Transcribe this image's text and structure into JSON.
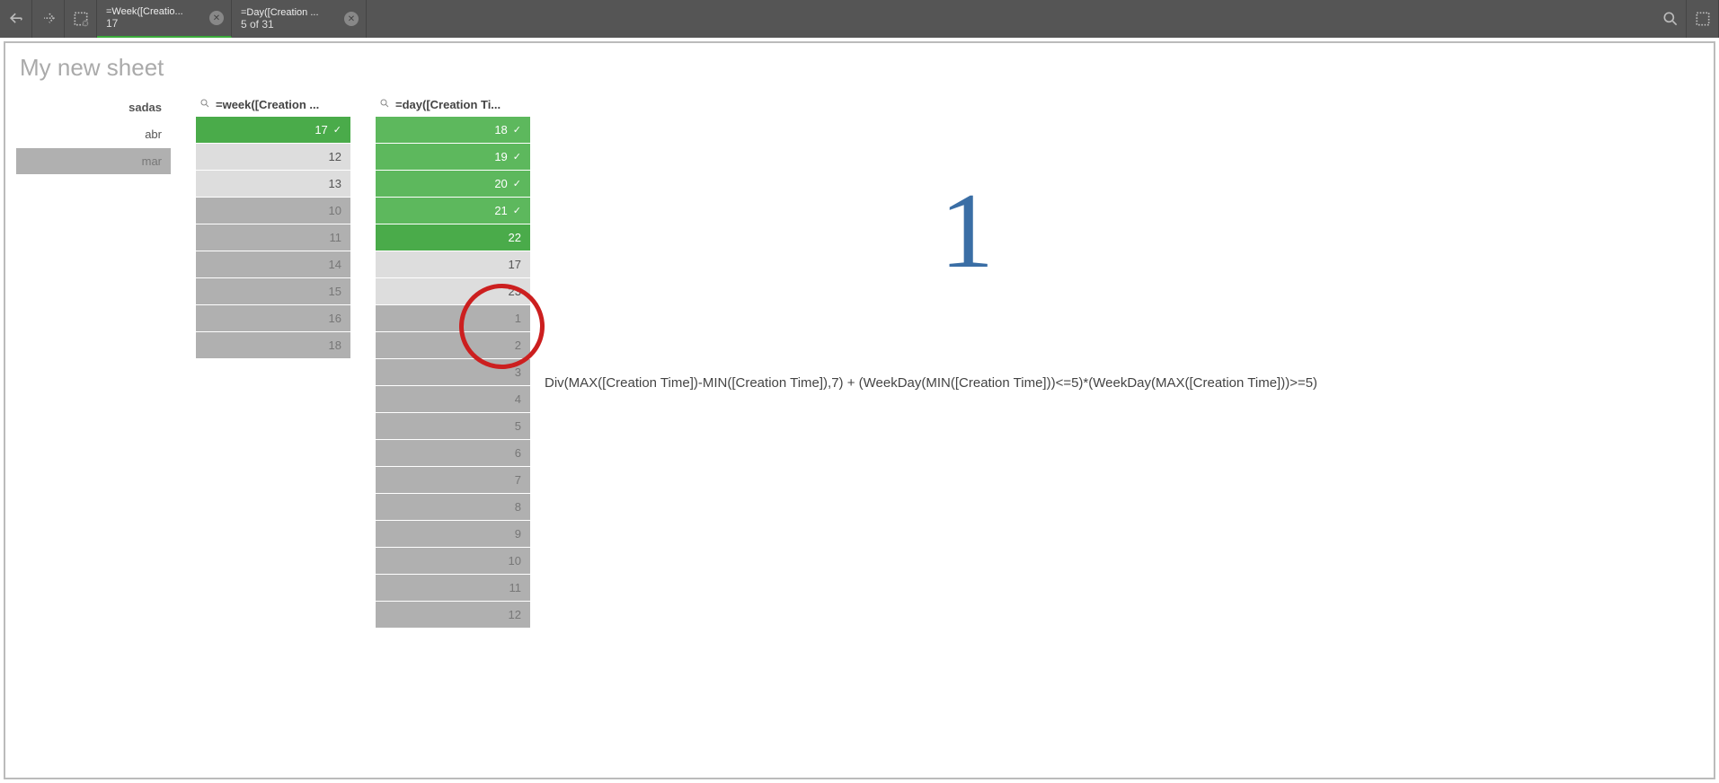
{
  "toolbar": {
    "selections": [
      {
        "title": "=Week([Creatio...",
        "sub": "17"
      },
      {
        "title": "=Day([Creation ...",
        "sub": "5 of 31"
      }
    ]
  },
  "sheet": {
    "title": "My new sheet"
  },
  "panes": {
    "sadas": {
      "header": "sadas",
      "items": [
        {
          "label": "abr",
          "state": "plain"
        },
        {
          "label": "mar",
          "state": "excluded"
        }
      ]
    },
    "week": {
      "header": "=week([Creation ...",
      "items": [
        {
          "label": "17",
          "state": "selected-bright",
          "checked": true
        },
        {
          "label": "12",
          "state": "possible-light"
        },
        {
          "label": "13",
          "state": "possible-light"
        },
        {
          "label": "10",
          "state": "excluded"
        },
        {
          "label": "11",
          "state": "excluded"
        },
        {
          "label": "14",
          "state": "excluded"
        },
        {
          "label": "15",
          "state": "excluded"
        },
        {
          "label": "16",
          "state": "excluded"
        },
        {
          "label": "18",
          "state": "excluded"
        }
      ]
    },
    "day": {
      "header": "=day([Creation Ti...",
      "items": [
        {
          "label": "18",
          "state": "selected",
          "checked": true
        },
        {
          "label": "19",
          "state": "selected",
          "checked": true
        },
        {
          "label": "20",
          "state": "selected",
          "checked": true
        },
        {
          "label": "21",
          "state": "selected",
          "checked": true
        },
        {
          "label": "22",
          "state": "selected-bright"
        },
        {
          "label": "17",
          "state": "possible-light"
        },
        {
          "label": "23",
          "state": "possible-light"
        },
        {
          "label": "1",
          "state": "excluded"
        },
        {
          "label": "2",
          "state": "excluded"
        },
        {
          "label": "3",
          "state": "excluded"
        },
        {
          "label": "4",
          "state": "excluded"
        },
        {
          "label": "5",
          "state": "excluded"
        },
        {
          "label": "6",
          "state": "excluded"
        },
        {
          "label": "7",
          "state": "excluded"
        },
        {
          "label": "8",
          "state": "excluded"
        },
        {
          "label": "9",
          "state": "excluded"
        },
        {
          "label": "10",
          "state": "excluded"
        },
        {
          "label": "11",
          "state": "excluded"
        },
        {
          "label": "12",
          "state": "excluded"
        }
      ]
    }
  },
  "kpi": {
    "value": "1"
  },
  "expression": "Div(MAX([Creation Time])-MIN([Creation Time]),7) + (WeekDay(MIN([Creation Time]))<=5)*(WeekDay(MAX([Creation Time]))>=5)"
}
